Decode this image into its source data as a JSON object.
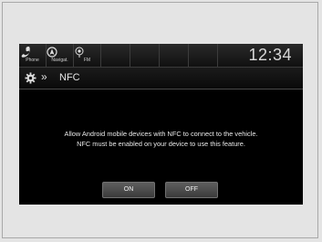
{
  "topbar": {
    "phone_label": "Phone",
    "navi_label": "Navigat.",
    "fm_label": "FM",
    "clock": "12:34",
    "icons": [
      "phone-icon",
      "navigation-icon",
      "radio-icon"
    ]
  },
  "header": {
    "breadcrumb_separator": "»",
    "title": "NFC",
    "icon": "gear-icon"
  },
  "body": {
    "line1": "Allow Android mobile devices with NFC to connect to the vehicle.",
    "line2": "NFC must be enabled on your device to use this feature."
  },
  "buttons": {
    "on_label": "ON",
    "off_label": "OFF"
  }
}
